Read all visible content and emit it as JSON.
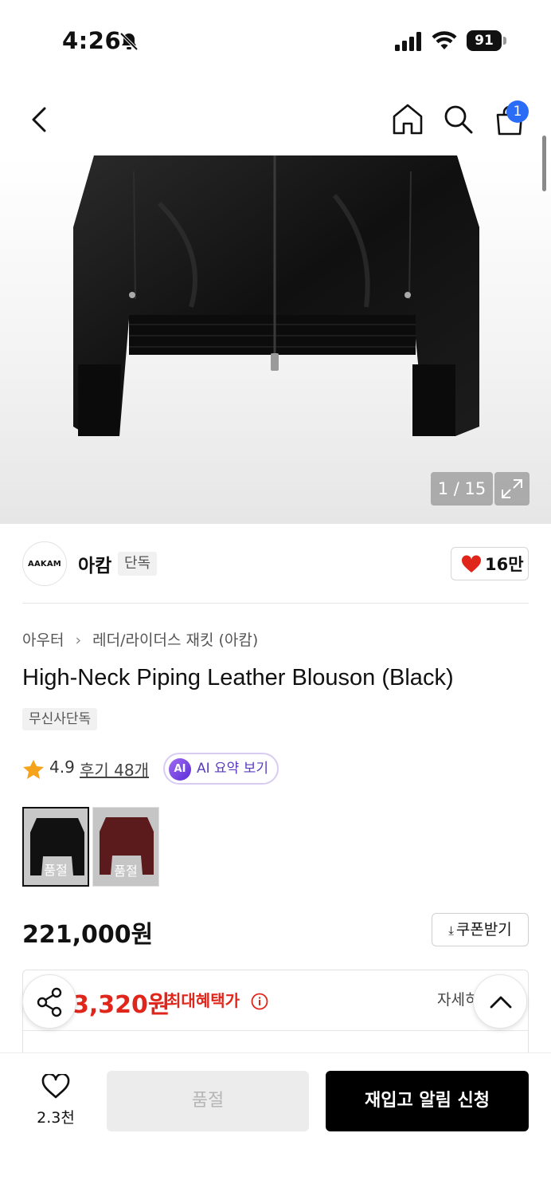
{
  "status_bar": {
    "time": "4:26",
    "battery": "91"
  },
  "nav": {
    "cart_count": "1"
  },
  "gallery": {
    "indicator": "1 / 15"
  },
  "brand": {
    "logo_text": "AAKAM",
    "name": "아캄",
    "tag": "단독",
    "likes": "16만"
  },
  "breadcrumb": {
    "category": "아우터",
    "sub_category": "레더/라이더스 재킷 (아캄)"
  },
  "product": {
    "title": "High-Neck Piping Leather Blouson (Black)",
    "badge": "무신사단독",
    "rating": "4.9",
    "reviews": "후기 48개",
    "ai_summary": "AI 요약 보기",
    "ai_badge": "AI"
  },
  "colors": [
    {
      "label": "품절",
      "color": "#111111"
    },
    {
      "label": "품절",
      "color": "#5b1a1c"
    }
  ],
  "price": {
    "original": "221,000원",
    "coupon_label": "쿠폰받기",
    "benefit_price": "3,320원",
    "benefit_label": "최대혜택가",
    "detail_link": "자세히"
  },
  "bottom": {
    "wish_count": "2.3천",
    "soldout_label": "품절",
    "restock_label": "재입고 알림 신청"
  },
  "theme": {
    "accent_red": "#e0251b",
    "badge_blue": "#2a6cf6"
  }
}
